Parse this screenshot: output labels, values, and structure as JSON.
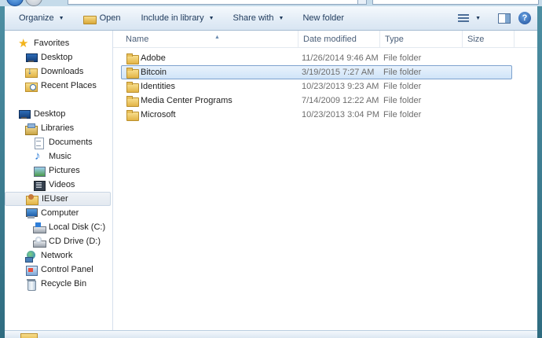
{
  "toolbar": {
    "organize": "Organize",
    "open": "Open",
    "include_in_library": "Include in library",
    "share_with": "Share with",
    "new_folder": "New folder",
    "help": "?"
  },
  "nav": {
    "favorites": "Favorites",
    "fav_desktop": "Desktop",
    "fav_downloads": "Downloads",
    "fav_recent": "Recent Places",
    "desktop": "Desktop",
    "libraries": "Libraries",
    "documents": "Documents",
    "music": "Music",
    "pictures": "Pictures",
    "videos": "Videos",
    "ieuser": "IEUser",
    "computer": "Computer",
    "local_disk": "Local Disk (C:)",
    "cd_drive": "CD Drive (D:)",
    "network": "Network",
    "control_panel": "Control Panel",
    "recycle_bin": "Recycle Bin"
  },
  "columns": {
    "name": "Name",
    "date_modified": "Date modified",
    "type": "Type",
    "size": "Size"
  },
  "files": [
    {
      "name": "Adobe",
      "date": "11/26/2014 9:46 AM",
      "type": "File folder"
    },
    {
      "name": "Bitcoin",
      "date": "3/19/2015 7:27 AM",
      "type": "File folder",
      "selected": true
    },
    {
      "name": "Identities",
      "date": "10/23/2013 9:23 AM",
      "type": "File folder"
    },
    {
      "name": "Media Center Programs",
      "date": "7/14/2009 12:22 AM",
      "type": "File folder"
    },
    {
      "name": "Microsoft",
      "date": "10/23/2013 3:04 PM",
      "type": "File folder"
    }
  ],
  "colors": {
    "selection_fill": "#d0e4f8",
    "selection_border": "#7da2ce",
    "toolbar_text": "#1e395b",
    "header_text": "#4c607a",
    "frame": "#3f7f93"
  }
}
